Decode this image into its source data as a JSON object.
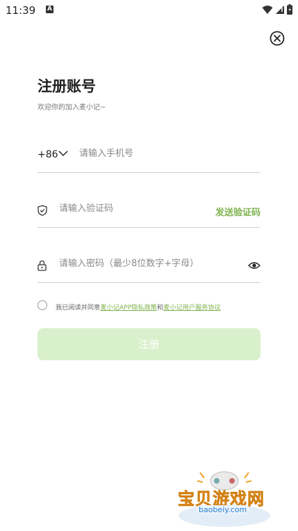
{
  "status_bar": {
    "time": "11:39",
    "notification_letter": "A"
  },
  "title": "注册账号",
  "subtitle": "欢迎你的加入麦小记~",
  "phone": {
    "country_code": "+86",
    "placeholder": "请输入手机号"
  },
  "code": {
    "placeholder": "请输入验证码",
    "send_label": "发送验证码"
  },
  "password": {
    "placeholder": "请输入密码（最少8位数字+字母）"
  },
  "agreement": {
    "prefix": "我已阅读并同意",
    "privacy_link": "麦小记APP隐私政策",
    "joiner": "和",
    "terms_link": "麦小记用户服务协议"
  },
  "submit_label": "注册",
  "watermark": {
    "text": "宝贝游戏网",
    "url": "baobeiy.com"
  },
  "colors": {
    "accent": "#7fb34e",
    "button_bg": "#d9f0cc"
  }
}
